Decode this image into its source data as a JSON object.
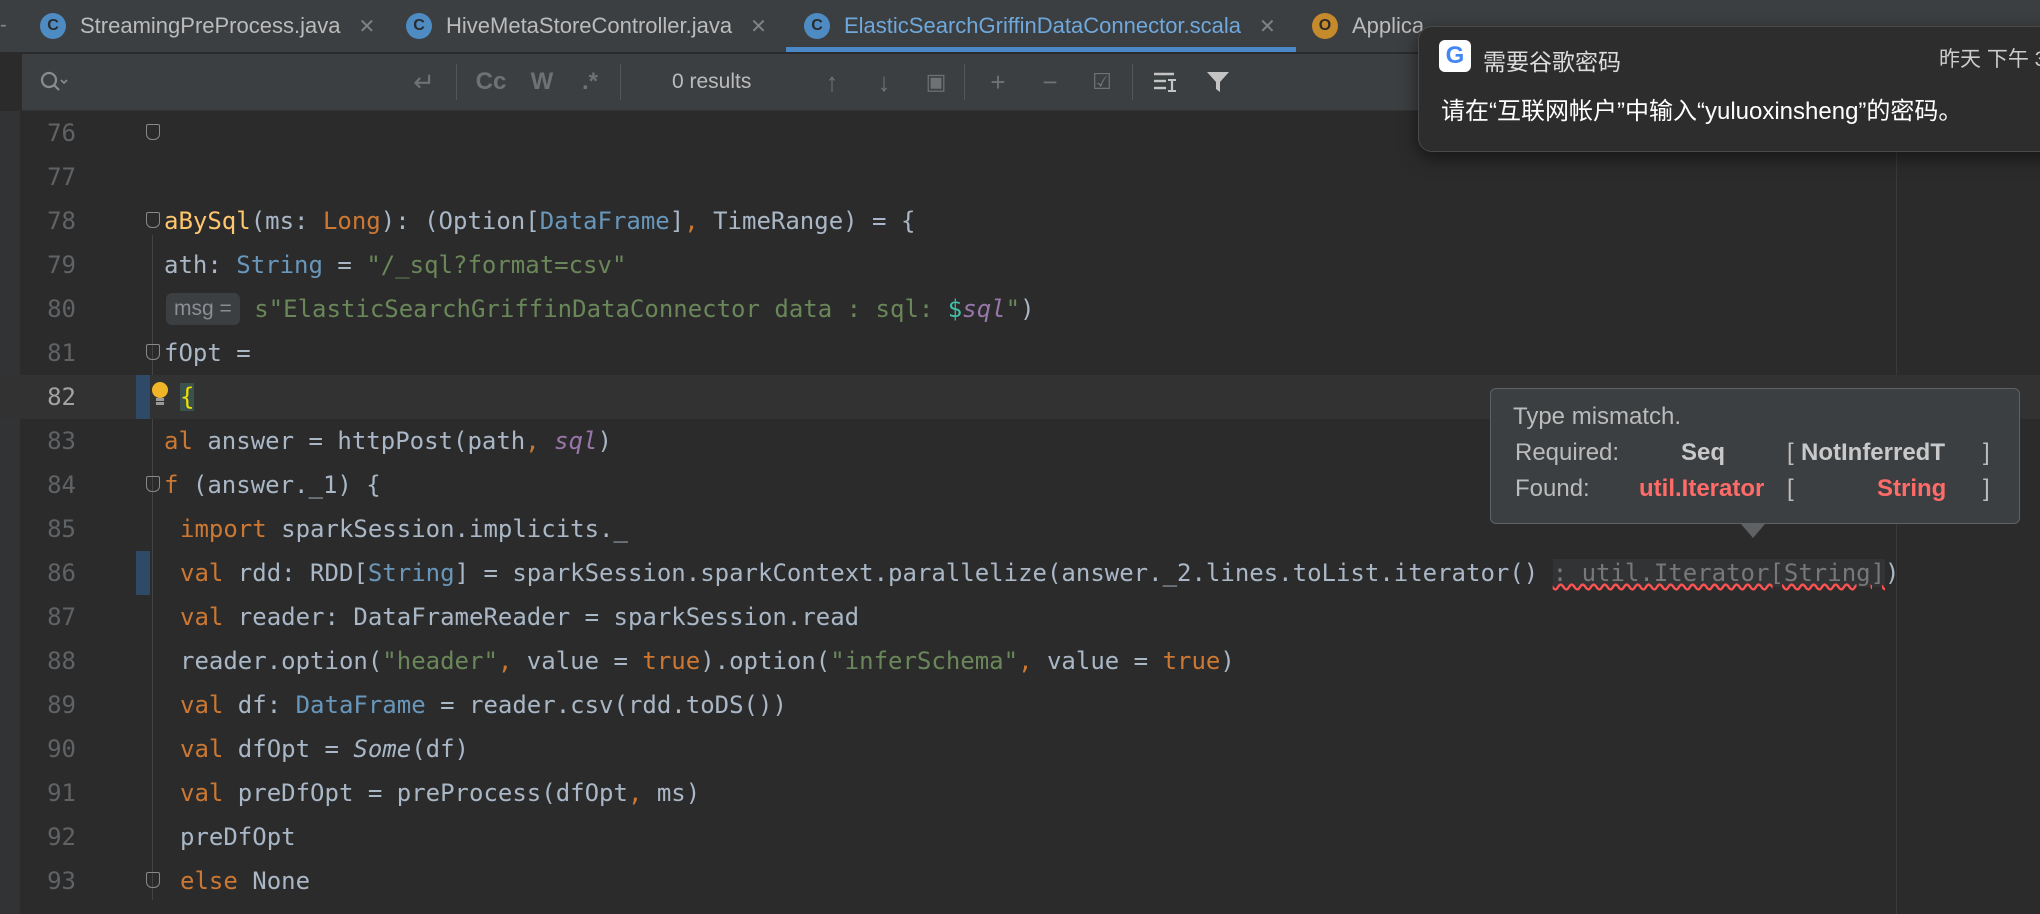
{
  "tabs": [
    {
      "label": "StreamingPreProcess.java",
      "icon": "C",
      "icon_color": "#4d8bc2"
    },
    {
      "label": "HiveMetaStoreController.java",
      "icon": "C",
      "icon_color": "#4d8bc2"
    },
    {
      "label": "ElasticSearchGriffinDataConnector.scala",
      "icon": "C",
      "icon_color": "#4d8bc2",
      "active": true
    },
    {
      "label": "Applica",
      "icon": "O",
      "icon_color": "#c58a2c"
    }
  ],
  "search": {
    "results_label": "0 results",
    "case_label": "Cc",
    "word_label": "W",
    "regex_label": ".*"
  },
  "editor": {
    "line_numbers": [
      "76",
      "77",
      "78",
      "79",
      "80",
      "81",
      "82",
      "83",
      "84",
      "85",
      "86",
      "87",
      "88",
      "89",
      "90",
      "91",
      "92",
      "93"
    ],
    "msg_hint": "msg =",
    "inlay_type": ": util.Iterator[String]"
  },
  "tooltip": {
    "title": "Type mismatch.",
    "required_label": "Required:",
    "required_type": "Seq",
    "required_param": "NotInferredT",
    "found_label": "Found:",
    "found_type": "util.Iterator",
    "found_param": "String",
    "open_bracket": "[",
    "close_bracket": "]"
  },
  "notification": {
    "title": "需要谷歌密码",
    "time": "昨天 下午 3",
    "body": "请在“互联网帐户”中输入“yuluoxinsheng”的密码。",
    "app_icon": "google-icon"
  },
  "colors": {
    "keyword": "#cc7832",
    "function": "#ffc66d",
    "string": "#6a8759",
    "type": "#6897bb",
    "error": "#ff6b68"
  }
}
